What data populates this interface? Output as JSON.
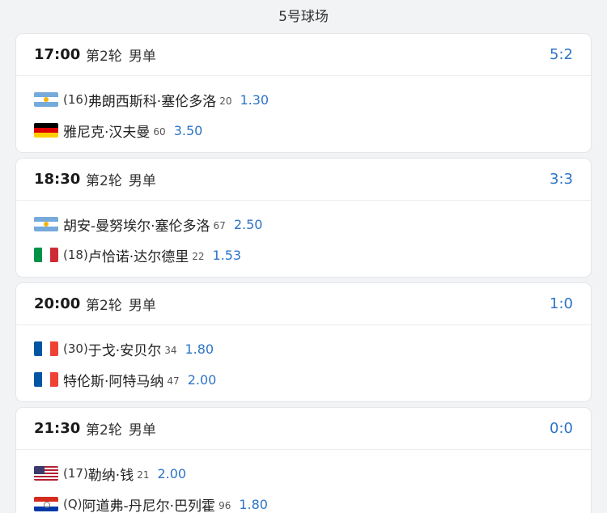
{
  "court": {
    "title": "5号球场"
  },
  "matches": [
    {
      "time": "17:00",
      "round": "第2轮",
      "event": "男单",
      "score": "5:2",
      "players": [
        {
          "flag": "argentina-flag",
          "seed": "(16)",
          "name": "弗朗西斯科·塞伦多洛",
          "rank": "20",
          "odds": "1.30"
        },
        {
          "flag": "germany-flag",
          "seed": "",
          "name": "雅尼克·汉夫曼",
          "rank": "60",
          "odds": "3.50"
        }
      ]
    },
    {
      "time": "18:30",
      "round": "第2轮",
      "event": "男单",
      "score": "3:3",
      "players": [
        {
          "flag": "argentina-flag",
          "seed": "",
          "name": "胡安-曼努埃尔·塞伦多洛",
          "rank": "67",
          "odds": "2.50"
        },
        {
          "flag": "italy-flag",
          "seed": "(18)",
          "name": "卢恰诺·达尔德里",
          "rank": "22",
          "odds": "1.53"
        }
      ]
    },
    {
      "time": "20:00",
      "round": "第2轮",
      "event": "男单",
      "score": "1:0",
      "players": [
        {
          "flag": "france-flag",
          "seed": "(30)",
          "name": "于戈·安贝尔",
          "rank": "34",
          "odds": "1.80"
        },
        {
          "flag": "france-flag",
          "seed": "",
          "name": "特伦斯·阿特马纳",
          "rank": "47",
          "odds": "2.00"
        }
      ]
    },
    {
      "time": "21:30",
      "round": "第2轮",
      "event": "男单",
      "score": "0:0",
      "players": [
        {
          "flag": "usa-flag",
          "seed": "(17)",
          "name": "勒纳·钱",
          "rank": "21",
          "odds": "2.00"
        },
        {
          "flag": "paraguay-flag",
          "seed": "(Q)",
          "name": "阿道弗-丹尼尔·巴列霍",
          "rank": "96",
          "odds": "1.80"
        }
      ]
    }
  ],
  "colors": {
    "accent": "#2c74c6",
    "background": "#f2f3f5",
    "card": "#ffffff"
  }
}
